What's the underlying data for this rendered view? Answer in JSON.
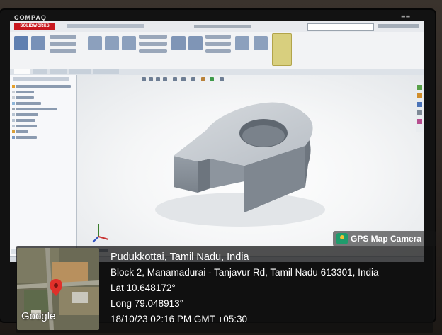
{
  "monitor": {
    "brand": "COMPAQ"
  },
  "app": {
    "logo_text": "SOLIDWORKS"
  },
  "overlay": {
    "badge_label": "GPS Map Camera",
    "map_provider": "Google",
    "place": "Pudukkottai, Tamil Nadu, India",
    "address": "Block 2, Manamadurai - Tanjavur Rd, Tamil Nadu 613301, India",
    "latitude": "Lat 10.648172°",
    "longitude": "Long 79.048913°",
    "datetime": "18/10/23 02:16 PM GMT +05:30"
  },
  "colors": {
    "app_accent": "#c8171f",
    "model_top": "#c9ced4",
    "model_side": "#7d858e",
    "badge_icon": "#1f9c6c",
    "map_pin": "#e0302a"
  }
}
